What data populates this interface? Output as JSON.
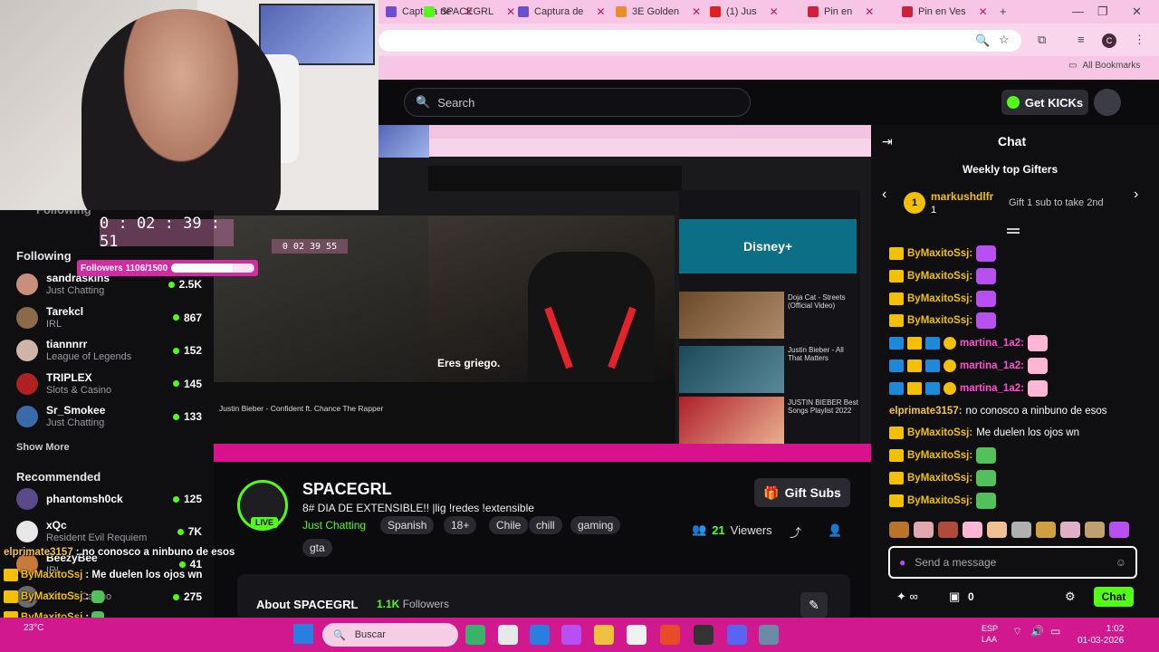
{
  "browser": {
    "tabs": [
      {
        "label": "Captura de",
        "color": "#6a4fd1"
      },
      {
        "label": "SPACEGRL",
        "color": "#53fc18"
      },
      {
        "label": "Captura de",
        "color": "#6a4fd1"
      },
      {
        "label": "3E Golden",
        "color": "#e88e2a"
      },
      {
        "label": "(1) Jus",
        "color": "#e02020"
      },
      {
        "label": "Pin en",
        "color": "#d11f3a"
      },
      {
        "label": "Pin en Ves",
        "color": "#d11f3a"
      }
    ],
    "all_bookmarks": "All Bookmarks",
    "profile_initial": "C"
  },
  "header": {
    "search_placeholder": "Search",
    "get_kicks": "Get KICKs"
  },
  "overlay": {
    "timer_main": "0 : 02 : 39 : 51",
    "timer_small": "0 02 39 55",
    "followers_label": "Followers 1106/1500",
    "followers_progress": 0.737
  },
  "sidebar": {
    "following_hidden_label": "Following",
    "following_title": "Following",
    "following": [
      {
        "name": "sandraskins",
        "category": "Just Chatting",
        "viewers": "2.5K",
        "color": "#c98f7a"
      },
      {
        "name": "Tarekcl",
        "category": "IRL",
        "viewers": "867",
        "color": "#8a6a4a"
      },
      {
        "name": "tiannnrr",
        "category": "League of Legends",
        "viewers": "152",
        "color": "#d0b4a8"
      },
      {
        "name": "TRIPLEX",
        "category": "Slots & Casino",
        "viewers": "145",
        "color": "#b02020"
      },
      {
        "name": "Sr_Smokee",
        "category": "Just Chatting",
        "viewers": "133",
        "color": "#3a6aa8"
      }
    ],
    "show_more": "Show More",
    "recommended_title": "Recommended",
    "recommended": [
      {
        "name": "phantomsh0ck",
        "category": "",
        "viewers": "125",
        "color": "#5a4a8a"
      },
      {
        "name": "xQc",
        "category": "Resident Evil Requiem",
        "viewers": "7K",
        "color": "#e8e8e8"
      },
      {
        "name": "BeezyBee",
        "category": "IRL",
        "viewers": "41",
        "color": "#c77a3a"
      },
      {
        "name": "",
        "category": "Slots & Casino",
        "viewers": "275",
        "color": "#6a6a6a"
      }
    ]
  },
  "player": {
    "subtitle": "Eres griego.",
    "yt_sidebar_title": "Disney+",
    "yt_video_label": "Justin Bieber - Confident ft. Chance The Rapper",
    "yt_side_items": [
      "Doja Cat - Streets (Official Video)",
      "Justin Bieber - All That Matters",
      "JUSTIN BIEBER Best Songs Playlist 2022"
    ]
  },
  "stream": {
    "name": "SPACEGRL",
    "title": "8#  DIA DE EXTENSIBLE!! |lig !redes !extensible",
    "category": "Just Chatting",
    "tags": [
      "Spanish",
      "18+",
      "Chile",
      "chill",
      "gaming",
      "gta"
    ],
    "live": "LIVE",
    "viewers_count": "21",
    "viewers_label": "Viewers",
    "gift_subs": "Gift Subs",
    "about_title": "About SPACEGRL",
    "about_followers_count": "1.1K",
    "about_followers_label": "Followers"
  },
  "chat": {
    "title": "Chat",
    "gifters_title": "Weekly top Gifters",
    "top_gifter": "markushdlfr",
    "top_gifter_count": "1",
    "gift_cta": "Gift 1 sub to take 2nd",
    "messages": [
      {
        "user": "ByMaxitoSsj:",
        "text": "",
        "style": "y",
        "badges": "crown"
      },
      {
        "user": "ByMaxitoSsj:",
        "text": "",
        "style": "y",
        "badges": "crown"
      },
      {
        "user": "ByMaxitoSsj:",
        "text": "",
        "style": "y",
        "badges": "crown"
      },
      {
        "user": "ByMaxitoSsj:",
        "text": "",
        "style": "y",
        "badges": "crown"
      },
      {
        "user": "martina_1a2:",
        "text": "",
        "style": "p",
        "badges": "multi"
      },
      {
        "user": "martina_1a2:",
        "text": "",
        "style": "p",
        "badges": "multi"
      },
      {
        "user": "martina_1a2:",
        "text": "",
        "style": "p",
        "badges": "multi"
      },
      {
        "user": "elprimate3157:",
        "text": "no conosco a ninbuno de esos",
        "style": "o",
        "badges": "none"
      },
      {
        "user": "ByMaxitoSsj:",
        "text": "Me duelen los ojos wn",
        "style": "y",
        "badges": "crown"
      },
      {
        "user": "ByMaxitoSsj:",
        "text": "",
        "style": "y",
        "badges": "crown"
      },
      {
        "user": "ByMaxitoSsj:",
        "text": "",
        "style": "y",
        "badges": "crown"
      },
      {
        "user": "ByMaxitoSsj:",
        "text": "",
        "style": "y",
        "badges": "crown"
      }
    ],
    "input_placeholder": "Send a message",
    "points": "0",
    "send": "Chat"
  },
  "overlay_chat": [
    {
      "user": "elprimate3157",
      "text": ": no conosco a ninbuno de esos"
    },
    {
      "user": "ByMaxitoSsj",
      "text": ": Me duelen los ojos wn"
    },
    {
      "user": "ByMaxitoSsj",
      "text": ":"
    },
    {
      "user": "ByMaxitoSsj",
      "text": ":"
    },
    {
      "user": "ByMaxitoSsj",
      "text": ":"
    }
  ],
  "taskbar": {
    "weather": "23°C",
    "search": "Buscar",
    "lang_top": "ESP",
    "lang_bottom": "LAA",
    "time": "1:02",
    "date": "01-03-2026"
  }
}
